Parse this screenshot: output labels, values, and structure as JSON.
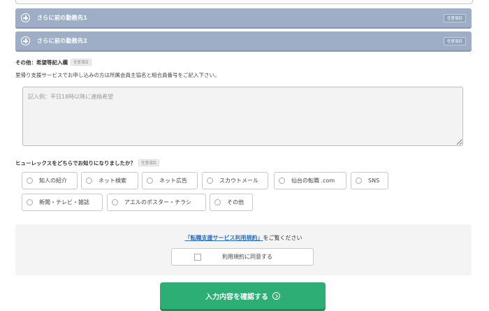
{
  "accordions": [
    {
      "title": "さらに前の勤務先1",
      "badge": "任意項目"
    },
    {
      "title": "さらに前の勤務先2",
      "badge": "任意項目"
    }
  ],
  "other": {
    "label": "その他：希望等記入欄",
    "badge": "任意項目",
    "note": "里帰り支援サービスでお申し込みの方は所属会員主協名と組合員番号をご記入下さい。",
    "placeholder": "記入例：平日18時以降に連絡希望",
    "value": ""
  },
  "source": {
    "label": "ヒューレックスをどちらでお知りになりましたか？",
    "badge": "任意項目",
    "options": [
      "知人の紹介",
      "ネット検索",
      "ネット広告",
      "スカウトメール",
      "仙台の転職 .com",
      "SNS",
      "新聞・テレビ・雑誌",
      "アエルのポスター・チラシ",
      "その他"
    ]
  },
  "terms": {
    "link_text": "「転職支援サービス利用規約」",
    "after_text": "をご覧ください",
    "checkbox_label": "利用規約に同意する"
  },
  "submit": {
    "label": "入力内容を確認する"
  },
  "colors": {
    "accordion": "#9eaec6",
    "submit": "#2cae74",
    "link": "#2a6fc2"
  }
}
